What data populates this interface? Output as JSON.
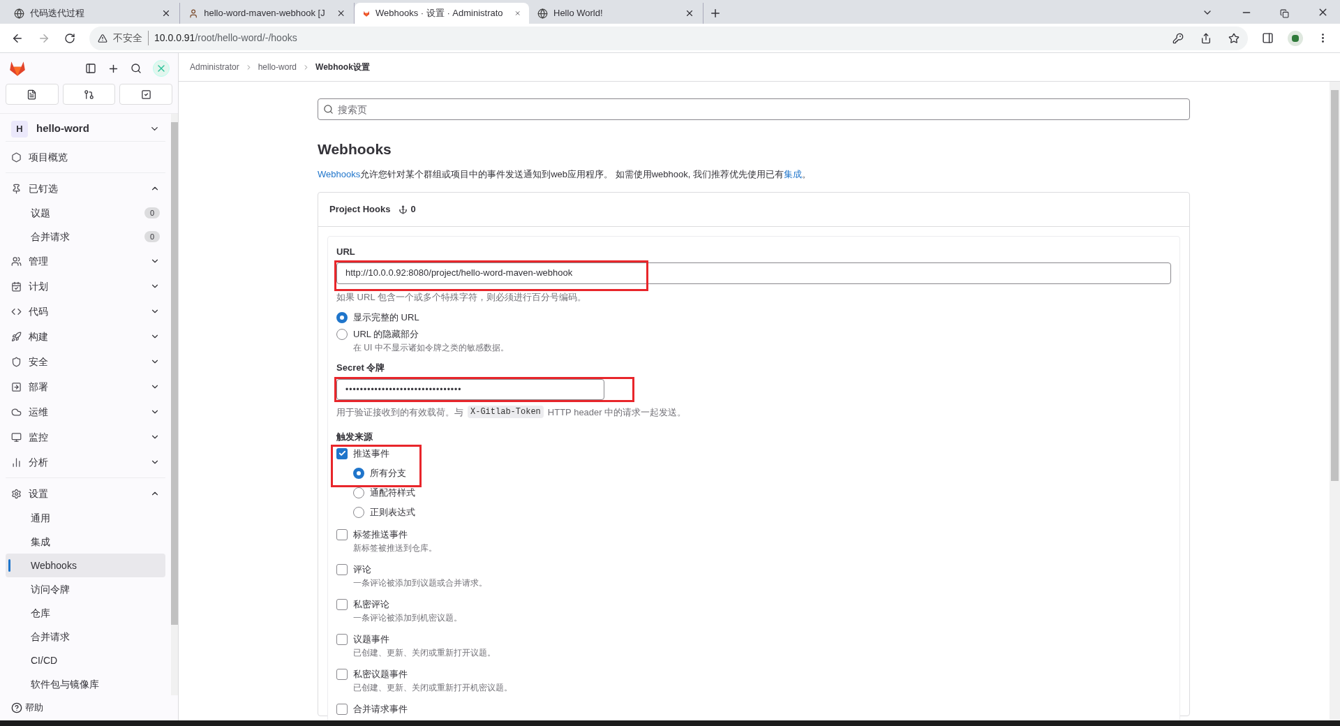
{
  "browser": {
    "tabs": [
      {
        "title": "代码迭代过程",
        "selected": false
      },
      {
        "title": "hello-word-maven-webhook [J",
        "selected": false
      },
      {
        "title": "Webhooks · 设置 · Administrato",
        "selected": true
      },
      {
        "title": "Hello World!",
        "selected": false
      }
    ],
    "security": "不安全",
    "url_host": "10.0.0.91",
    "url_path": "/root/hello-word/-/hooks"
  },
  "sidebar": {
    "project_initial": "H",
    "project_name": "hello-word",
    "help": "帮助",
    "items": [
      {
        "kind": "link",
        "label": "项目概览"
      },
      {
        "kind": "section",
        "label": "已钉选",
        "expanded": true,
        "children": [
          {
            "label": "议题",
            "count": "0",
            "selected": false
          },
          {
            "label": "合并请求",
            "count": "0",
            "selected": false
          }
        ]
      },
      {
        "kind": "section",
        "label": "管理",
        "expanded": false
      },
      {
        "kind": "section",
        "label": "计划",
        "expanded": false
      },
      {
        "kind": "section",
        "label": "代码",
        "expanded": false
      },
      {
        "kind": "section",
        "label": "构建",
        "expanded": false
      },
      {
        "kind": "section",
        "label": "安全",
        "expanded": false
      },
      {
        "kind": "section",
        "label": "部署",
        "expanded": false
      },
      {
        "kind": "section",
        "label": "运维",
        "expanded": false
      },
      {
        "kind": "section",
        "label": "监控",
        "expanded": false
      },
      {
        "kind": "section",
        "label": "分析",
        "expanded": false
      },
      {
        "kind": "section",
        "label": "设置",
        "expanded": true,
        "children": [
          {
            "label": "通用",
            "selected": false
          },
          {
            "label": "集成",
            "selected": false
          },
          {
            "label": "Webhooks",
            "selected": true
          },
          {
            "label": "访问令牌",
            "selected": false
          },
          {
            "label": "仓库",
            "selected": false
          },
          {
            "label": "合并请求",
            "selected": false
          },
          {
            "label": "CI/CD",
            "selected": false
          },
          {
            "label": "软件包与镜像库",
            "selected": false
          }
        ]
      }
    ]
  },
  "breadcrumb": [
    "Administrator",
    "hello-word",
    "Webhook设置"
  ],
  "search": {
    "placeholder": "搜索页"
  },
  "heading": "Webhooks",
  "intro": [
    {
      "text": "Webhooks",
      "link": true
    },
    {
      "text": "允许您针对某个群组或项目中的事件发送通知到web应用程序。 如需使用webhook, 我们推荐优先使用已有",
      "link": false
    },
    {
      "text": "集成",
      "link": true
    },
    {
      "text": "。",
      "link": false
    }
  ],
  "card": {
    "title": "Project Hooks",
    "count": "0"
  },
  "form": {
    "url_label": "URL",
    "url_value": "http://10.0.0.92:8080/project/hello-word-maven-webhook",
    "url_highlighted": true,
    "url_help": "如果 URL 包含一个或多个特殊字符，则必须进行百分号编码。",
    "url_options": [
      {
        "label": "显示完整的 URL",
        "selected": true
      },
      {
        "label": "URL 的隐藏部分",
        "description": "在 UI 中不显示诸如令牌之类的敏感数据。",
        "selected": false
      }
    ],
    "secret_label": "Secret 令牌",
    "secret_value": "••••••••••••••••••••••••••••••••",
    "secret_highlighted": true,
    "secret_help": [
      {
        "text": "用于验证接收到的有效载荷。与",
        "code": false
      },
      {
        "text": "X-Gitlab-Token",
        "code": true
      },
      {
        "text": "HTTP header 中的请求一起发送。",
        "code": false
      }
    ],
    "trigger_label": "触发来源",
    "triggers": [
      {
        "label": "推送事件",
        "checked": true,
        "highlighted": true,
        "options": [
          {
            "label": "所有分支",
            "selected": true
          },
          {
            "label": "通配符样式",
            "selected": false
          },
          {
            "label": "正则表达式",
            "selected": false
          }
        ]
      },
      {
        "label": "标签推送事件",
        "description": "新标签被推送到仓库。",
        "checked": false,
        "highlighted": false
      },
      {
        "label": "评论",
        "description": "一条评论被添加到议题或合并请求。",
        "checked": false,
        "highlighted": false
      },
      {
        "label": "私密评论",
        "description": "一条评论被添加到机密议题。",
        "checked": false,
        "highlighted": false
      },
      {
        "label": "议题事件",
        "description": "已创建、更新、关闭或重新打开议题。",
        "checked": false,
        "highlighted": false
      },
      {
        "label": "私密议题事件",
        "description": "已创建、更新、关闭或重新打开机密议题。",
        "checked": false,
        "highlighted": false
      },
      {
        "label": "合并请求事件",
        "checked": false,
        "highlighted": false
      }
    ]
  }
}
